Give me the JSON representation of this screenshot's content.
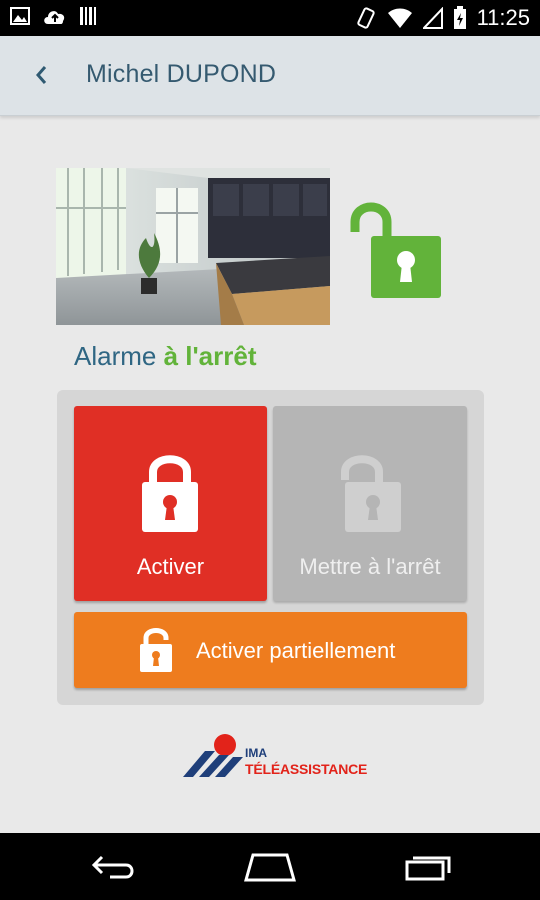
{
  "status_bar": {
    "time": "11:25",
    "icons": [
      "image-icon",
      "cloud-upload-icon",
      "barcode-icon",
      "vibrate-icon",
      "wifi-icon",
      "signal-icon",
      "battery-icon"
    ]
  },
  "header": {
    "title": "Michel DUPOND",
    "back_icon": "chevron-left-icon"
  },
  "alarm": {
    "label": "Alarme",
    "state": "à l'arrêt",
    "state_icon": "unlocked-padlock-icon",
    "state_color": "#62b33a"
  },
  "controls": {
    "activate_label": "Activer",
    "stop_label": "Mettre à l'arrêt",
    "partial_label": "Activer partiellement",
    "activate_color": "#e02f25",
    "stop_color": "#b5b5b5",
    "partial_color": "#ee7c1e"
  },
  "logo": {
    "line1": "IMA",
    "line2": "TÉLÉASSISTANCE"
  },
  "nav": {
    "icons": [
      "back-icon",
      "home-icon",
      "recent-apps-icon"
    ]
  }
}
